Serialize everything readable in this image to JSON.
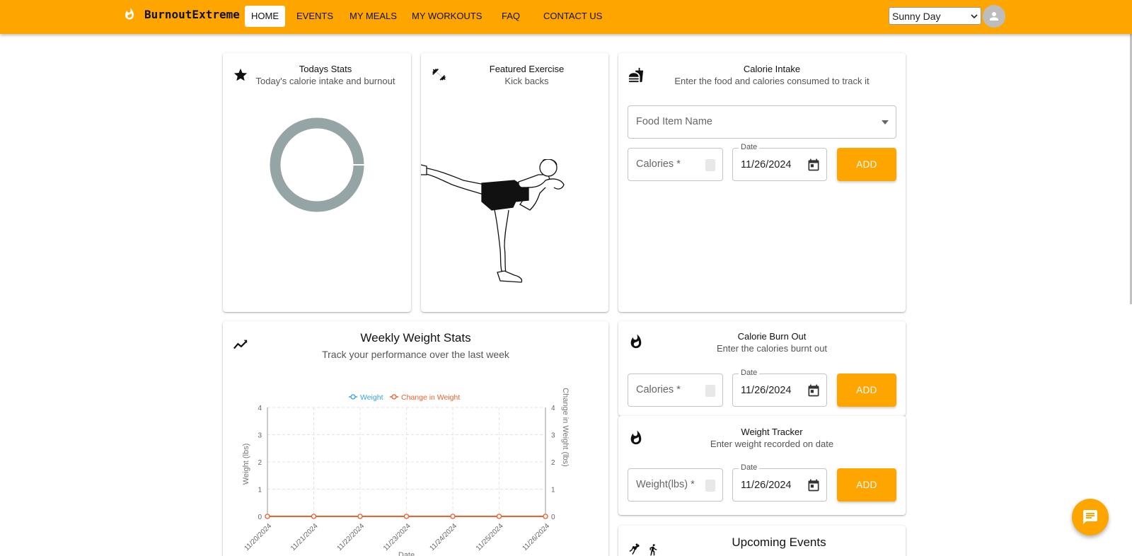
{
  "header": {
    "brand": "BurnoutExtreme",
    "nav": [
      "HOME",
      "EVENTS",
      "MY MEALS",
      "MY WORKOUTS",
      "FAQ",
      "CONTACT US"
    ],
    "active_nav": "HOME",
    "theme_value": "Sunny Day"
  },
  "todays_stats": {
    "title": "Todays Stats",
    "subtitle": "Today's calorie intake and burnout"
  },
  "featured_exercise": {
    "title": "Featured Exercise",
    "subtitle": "Kick backs"
  },
  "calorie_intake": {
    "title": "Calorie Intake",
    "subtitle": "Enter the food and calories consumed to track it",
    "food_placeholder": "Food Item Name",
    "calories_label": "Calories *",
    "date_label": "Date",
    "date_value": "11/26/2024",
    "add_label": "ADD"
  },
  "weekly_weight": {
    "title": "Weekly Weight Stats",
    "subtitle": "Track your performance over the last week"
  },
  "calorie_burn": {
    "title": "Calorie Burn Out",
    "subtitle": "Enter the calories burnt out",
    "calories_label": "Calories *",
    "date_label": "Date",
    "date_value": "11/26/2024",
    "add_label": "ADD"
  },
  "weight_tracker": {
    "title": "Weight Tracker",
    "subtitle": "Enter weight recorded on date",
    "weight_label": "Weight(lbs) *",
    "date_label": "Date",
    "date_value": "11/26/2024",
    "add_label": "ADD"
  },
  "upcoming_events": {
    "title": "Upcoming Events"
  },
  "colors": {
    "accent": "#ffa500",
    "weight_series": "#36a2eb",
    "change_series": "#f0602b",
    "donut": "#95a5a6"
  },
  "chart_data": [
    {
      "type": "pie",
      "title": "",
      "values": [
        1
      ],
      "note_style": "donut"
    },
    {
      "type": "line",
      "categories": [
        "11/20/2024",
        "11/21/2024",
        "11/22/2024",
        "11/23/2024",
        "11/24/2024",
        "11/25/2024",
        "11/26/2024"
      ],
      "series": [
        {
          "name": "Weight",
          "values": [
            0,
            0,
            0,
            0,
            0,
            0,
            0
          ]
        },
        {
          "name": "Change in Weight",
          "values": [
            0,
            0,
            0,
            0,
            0,
            0,
            0
          ]
        }
      ],
      "xlabel": "Date",
      "ylabel": "Weight (lbs)",
      "y2label": "Change in Weight (lbs)",
      "ylim": [
        0,
        4
      ],
      "y2lim": [
        0,
        4
      ],
      "yticks": [
        "0",
        "1",
        "2",
        "3",
        "4"
      ],
      "legend": "top",
      "grid": true
    }
  ]
}
